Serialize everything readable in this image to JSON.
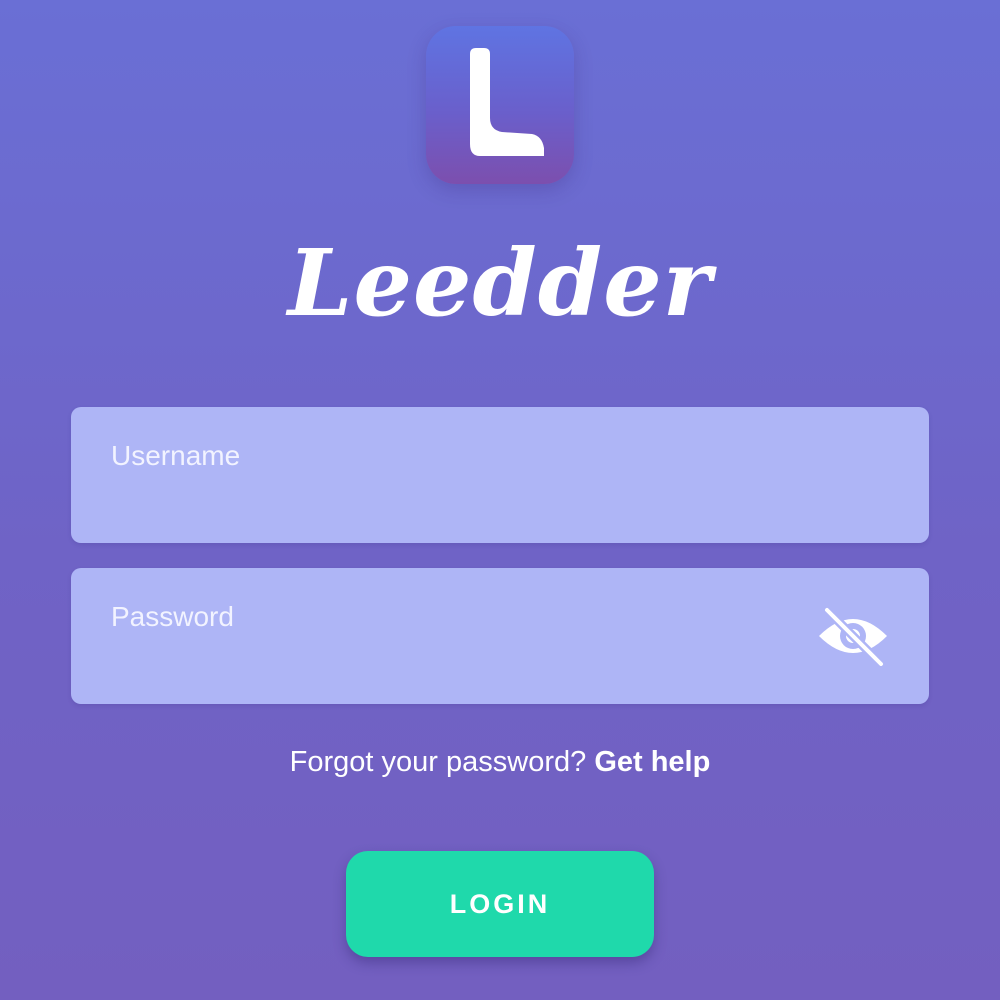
{
  "brand": {
    "name": "Leedder",
    "logo_letter": "L",
    "logo_icon": "brand-logo-icon"
  },
  "form": {
    "username": {
      "placeholder": "Username",
      "value": ""
    },
    "password": {
      "placeholder": "Password",
      "value": "",
      "visibility_icon": "eye-slash-icon"
    },
    "forgot_text": "Forgot your password?",
    "help_link": "Get help",
    "login_label": "LOGIN"
  },
  "colors": {
    "background_top": "#6a6fd5",
    "background_bottom": "#735fc0",
    "field_fill": "#aeb5f6",
    "accent_button": "#1fd9ab"
  }
}
